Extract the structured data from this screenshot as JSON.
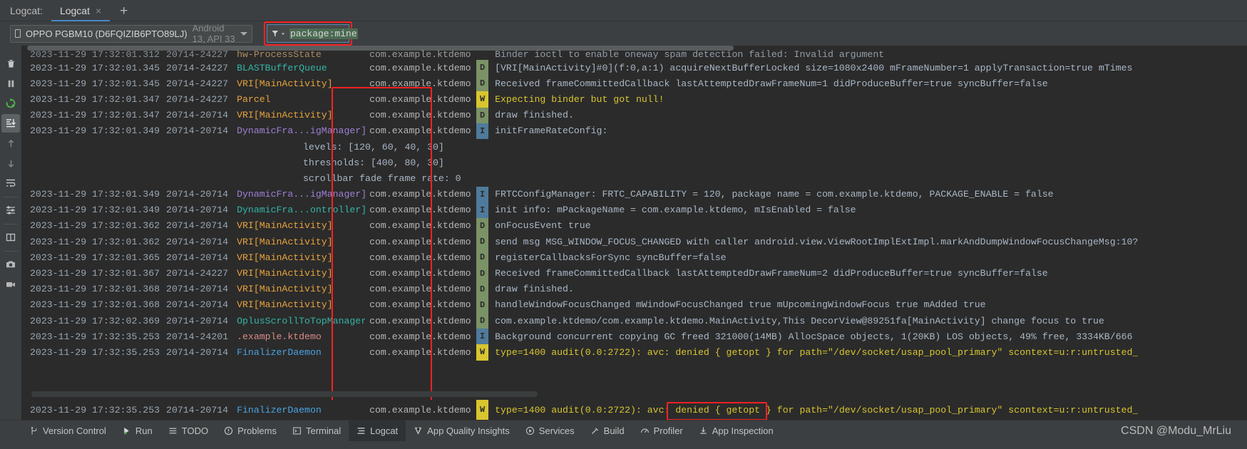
{
  "window": {
    "tool_label": "Logcat:",
    "tab_title": "Logcat",
    "tab_close": "×",
    "tab_add": "+"
  },
  "device_selector": {
    "icon": "phone-icon",
    "name": "OPPO PGBM10 (D6FQIZIB6PTO89LJ)",
    "api": "Android 13, API 33"
  },
  "filter": {
    "icon": "funnel-icon",
    "value": "package:mine",
    "highlight_color": "#4b6b52",
    "outline_color": "#fd2222"
  },
  "left_toolbar": [
    {
      "name": "clear-logcat-icon",
      "title": "Clear Logcat",
      "active": false
    },
    {
      "name": "pause-icon",
      "title": "Pause",
      "active": false
    },
    {
      "name": "restart-icon",
      "title": "Restart Logcat",
      "active": false
    },
    {
      "name": "scroll-to-end-icon",
      "title": "Scroll to the End",
      "active": true
    },
    {
      "name": "previous-occurrence-icon",
      "title": "Previous Occurrence",
      "active": false
    },
    {
      "name": "next-occurrence-icon",
      "title": "Next Occurrence",
      "active": false
    },
    {
      "name": "soft-wrap-icon",
      "title": "Soft-Wrap",
      "active": false
    },
    {
      "name": "configure-icon",
      "title": "Configure Logcat Formatting Options",
      "active": false
    },
    {
      "name": "split-panel-icon",
      "title": "Split Panels",
      "active": false
    },
    {
      "name": "screenshot-icon",
      "title": "Take Screenshot",
      "active": false
    },
    {
      "name": "screen-record-icon",
      "title": "Screen Record",
      "active": false
    }
  ],
  "logs": [
    {
      "time": "2023-11-29 17:32:01.312",
      "pid": "20714-24227",
      "tag": "hw-ProcessState",
      "tag_color": "#c9a26d",
      "package": "com.example.ktdemo",
      "level": "",
      "message": "Binder ioctl to enable oneway spam detection failed: Invalid argument",
      "msg_color": "#a9b7c6",
      "clipped_top": true
    },
    {
      "time": "2023-11-29 17:32:01.345",
      "pid": "20714-24227",
      "tag": "BLASTBufferQueue",
      "tag_color": "#33b5a5",
      "package": "com.example.ktdemo",
      "level": "D",
      "message": "[VRI[MainActivity]#0](f:0,a:1) acquireNextBufferLocked size=1080x2400 mFrameNumber=1 applyTransaction=true mTimes",
      "msg_color": "#a9b7c6"
    },
    {
      "time": "2023-11-29 17:32:01.345",
      "pid": "20714-24227",
      "tag": "VRI[MainActivity]",
      "tag_color": "#e8a33d",
      "package": "com.example.ktdemo",
      "level": "D",
      "message": "Received frameCommittedCallback lastAttemptedDrawFrameNum=1 didProduceBuffer=true syncBuffer=false",
      "msg_color": "#a9b7c6"
    },
    {
      "time": "2023-11-29 17:32:01.347",
      "pid": "20714-24227",
      "tag": "Parcel",
      "tag_color": "#e8a33d",
      "package": "com.example.ktdemo",
      "level": "W",
      "message": "Expecting binder but got null!",
      "msg_color": "#d8c530"
    },
    {
      "time": "2023-11-29 17:32:01.347",
      "pid": "20714-20714",
      "tag": "VRI[MainActivity]",
      "tag_color": "#e8a33d",
      "package": "com.example.ktdemo",
      "level": "D",
      "message": "draw finished.",
      "msg_color": "#a9b7c6"
    },
    {
      "time": "2023-11-29 17:32:01.349",
      "pid": "20714-20714",
      "tag": "DynamicFra...igManager]",
      "tag_color": "#9f7fd4",
      "package": "com.example.ktdemo",
      "level": "I",
      "message": "initFrameRateConfig:",
      "msg_color": "#a9b7c6"
    },
    {
      "time": "",
      "pid": "",
      "tag": "",
      "tag_color": "",
      "package": "",
      "level": "",
      "message": "        levels: [120, 60, 40, 30]",
      "msg_color": "#a9b7c6"
    },
    {
      "time": "",
      "pid": "",
      "tag": "",
      "tag_color": "",
      "package": "",
      "level": "",
      "message": "        thresholds: [400, 80, 30]",
      "msg_color": "#a9b7c6"
    },
    {
      "time": "",
      "pid": "",
      "tag": "",
      "tag_color": "",
      "package": "",
      "level": "",
      "message": "        scrollbar fade frame rate: 0",
      "msg_color": "#a9b7c6"
    },
    {
      "time": "2023-11-29 17:32:01.349",
      "pid": "20714-20714",
      "tag": "DynamicFra...igManager]",
      "tag_color": "#9f7fd4",
      "package": "com.example.ktdemo",
      "level": "I",
      "message": "FRTCConfigManager: FRTC_CAPABILITY = 120, package name = com.example.ktdemo, PACKAGE_ENABLE = false",
      "msg_color": "#a9b7c6"
    },
    {
      "time": "2023-11-29 17:32:01.349",
      "pid": "20714-20714",
      "tag": "DynamicFra...ontroller]",
      "tag_color": "#33b5a5",
      "package": "com.example.ktdemo",
      "level": "I",
      "message": "init info: mPackageName = com.example.ktdemo, mIsEnabled = false",
      "msg_color": "#a9b7c6"
    },
    {
      "time": "2023-11-29 17:32:01.362",
      "pid": "20714-20714",
      "tag": "VRI[MainActivity]",
      "tag_color": "#e8a33d",
      "package": "com.example.ktdemo",
      "level": "D",
      "message": "onFocusEvent true",
      "msg_color": "#a9b7c6"
    },
    {
      "time": "2023-11-29 17:32:01.362",
      "pid": "20714-20714",
      "tag": "VRI[MainActivity]",
      "tag_color": "#e8a33d",
      "package": "com.example.ktdemo",
      "level": "D",
      "message": "send msg MSG_WINDOW_FOCUS_CHANGED with caller android.view.ViewRootImplExtImpl.markAndDumpWindowFocusChangeMsg:10?",
      "msg_color": "#a9b7c6"
    },
    {
      "time": "2023-11-29 17:32:01.365",
      "pid": "20714-20714",
      "tag": "VRI[MainActivity]",
      "tag_color": "#e8a33d",
      "package": "com.example.ktdemo",
      "level": "D",
      "message": "registerCallbacksForSync syncBuffer=false",
      "msg_color": "#a9b7c6"
    },
    {
      "time": "2023-11-29 17:32:01.367",
      "pid": "20714-24227",
      "tag": "VRI[MainActivity]",
      "tag_color": "#e8a33d",
      "package": "com.example.ktdemo",
      "level": "D",
      "message": "Received frameCommittedCallback lastAttemptedDrawFrameNum=2 didProduceBuffer=true syncBuffer=false",
      "msg_color": "#a9b7c6"
    },
    {
      "time": "2023-11-29 17:32:01.368",
      "pid": "20714-20714",
      "tag": "VRI[MainActivity]",
      "tag_color": "#e8a33d",
      "package": "com.example.ktdemo",
      "level": "D",
      "message": "draw finished.",
      "msg_color": "#a9b7c6"
    },
    {
      "time": "2023-11-29 17:32:01.368",
      "pid": "20714-20714",
      "tag": "VRI[MainActivity]",
      "tag_color": "#e8a33d",
      "package": "com.example.ktdemo",
      "level": "D",
      "message": "handleWindowFocusChanged mWindowFocusChanged true mUpcomingWindowFocus true mAdded true",
      "msg_color": "#a9b7c6"
    },
    {
      "time": "2023-11-29 17:32:02.369",
      "pid": "20714-20714",
      "tag": "OplusScrollToTopManager",
      "tag_color": "#33b5a5",
      "package": "com.example.ktdemo",
      "level": "D",
      "message": "com.example.ktdemo/com.example.ktdemo.MainActivity,This DecorView@89251fa[MainActivity] change focus to true",
      "msg_color": "#a9b7c6"
    },
    {
      "time": "2023-11-29 17:32:35.253",
      "pid": "20714-24201",
      "tag": ".example.ktdemo",
      "tag_color": "#d98a8a",
      "package": "com.example.ktdemo",
      "level": "I",
      "message": "Background concurrent copying GC freed 321000(14MB) AllocSpace objects, 1(20KB) LOS objects, 49% free, 3334KB/666",
      "msg_color": "#a9b7c6"
    },
    {
      "time": "2023-11-29 17:32:35.253",
      "pid": "20714-20714",
      "tag": "FinalizerDaemon",
      "tag_color": "#4aa3e0",
      "package": "com.example.ktdemo",
      "level": "W",
      "message": "type=1400 audit(0.0:2722): avc: denied { getopt } for path=\"/dev/socket/usap_pool_primary\" scontext=u:r:untrusted_",
      "msg_color": "#d8c530"
    }
  ],
  "bottom_bar": {
    "items": [
      {
        "name": "version-control",
        "label": "Version Control",
        "icon": "branch-icon",
        "active": false
      },
      {
        "name": "run",
        "label": "Run",
        "icon": "play-icon",
        "active": false
      },
      {
        "name": "todo",
        "label": "TODO",
        "icon": "list-icon",
        "active": false
      },
      {
        "name": "problems",
        "label": "Problems",
        "icon": "warning-icon",
        "active": false
      },
      {
        "name": "terminal",
        "label": "Terminal",
        "icon": "terminal-icon",
        "active": false
      },
      {
        "name": "logcat",
        "label": "Logcat",
        "icon": "logcat-icon",
        "active": true
      },
      {
        "name": "app-quality-insights",
        "label": "App Quality Insights",
        "icon": "gem-icon",
        "active": false
      },
      {
        "name": "services",
        "label": "Services",
        "icon": "services-icon",
        "active": false
      },
      {
        "name": "build",
        "label": "Build",
        "icon": "hammer-icon",
        "active": false
      },
      {
        "name": "profiler",
        "label": "Profiler",
        "icon": "profiler-icon",
        "active": false
      },
      {
        "name": "app-inspection",
        "label": "App Inspection",
        "icon": "inspect-icon",
        "active": false
      }
    ],
    "watermark": "CSDN @Modu_MrLiu"
  }
}
